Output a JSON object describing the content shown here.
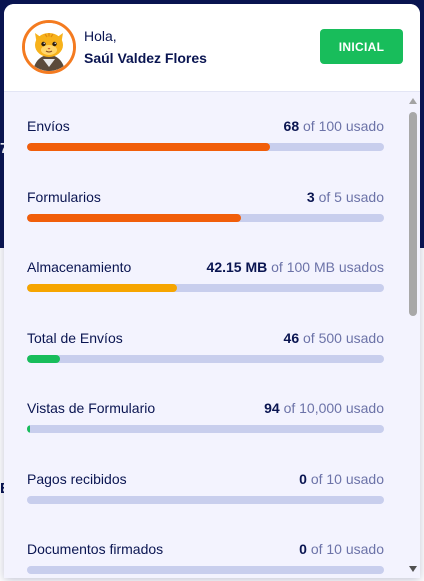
{
  "header": {
    "greeting": "Hola,",
    "user_name": "Saúl Valdez Flores",
    "plan_button_label": "INICIAL"
  },
  "background": {
    "edge_glyph_1": "7",
    "edge_glyph_2": "E"
  },
  "usage": {
    "of_text": "of",
    "items": [
      {
        "label": "Envíos",
        "value": "68",
        "limit_text": "100 usado",
        "fraction": 0.68,
        "color": "#f15e0a"
      },
      {
        "label": "Formularios",
        "value": "3",
        "limit_text": "5 usado",
        "fraction": 0.6,
        "color": "#f15e0a"
      },
      {
        "label": "Almacenamiento",
        "value": "42.15 MB",
        "limit_text": "100 MB usados",
        "fraction": 0.4215,
        "color": "#f6a500"
      },
      {
        "label": "Total de Envíos",
        "value": "46",
        "limit_text": "500 usado",
        "fraction": 0.092,
        "color": "#18bd5b"
      },
      {
        "label": "Vistas de Formulario",
        "value": "94",
        "limit_text": "10,000 usado",
        "fraction": 0.0094,
        "color": "#18bd5b"
      },
      {
        "label": "Pagos recibidos",
        "value": "0",
        "limit_text": "10 usado",
        "fraction": 0,
        "color": "#18bd5b"
      },
      {
        "label": "Documentos firmados",
        "value": "0",
        "limit_text": "10 usado",
        "fraction": 0,
        "color": "#18bd5b"
      }
    ]
  },
  "colors": {
    "brand_navy": "#0a1551",
    "track": "#c8ceed",
    "panel_bg": "#f3f3fe",
    "plan_button": "#18bd5b",
    "avatar_ring": "#f47b20"
  }
}
